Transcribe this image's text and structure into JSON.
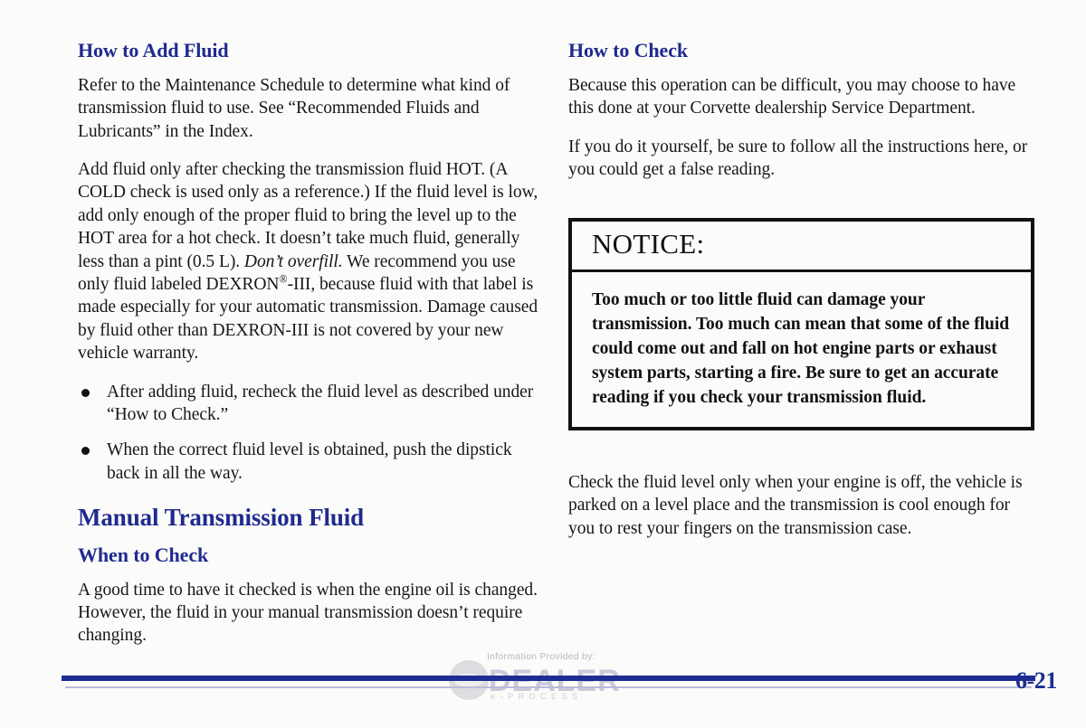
{
  "page": {
    "number": "6-21",
    "accent_color": "#1f2a8f",
    "footer_rule_color": "#1d2d93"
  },
  "left_column": {
    "heading_add_fluid": "How to Add Fluid",
    "paragraphs": [
      "Refer to the Maintenance Schedule to determine what kind of transmission fluid to use. See “Recommended Fluids and Lubricants” in the Index."
    ],
    "dexron_paragraph": {
      "part1": "Add fluid only after checking the transmission fluid HOT. (A COLD check is used only as a reference.) If the fluid level is low, add only enough of the proper fluid to bring the level up to the HOT area for a hot check. It doesn’t take much fluid, generally less than a pint (0.5 L). ",
      "italic": "Don’t overfill.",
      "part2": " We recommend you use only fluid labeled DEXRON",
      "registered": "®",
      "part3": "-III, because fluid with that label is made especially for your automatic transmission. Damage caused by fluid other than DEXRON-III is not covered by your new vehicle warranty."
    },
    "bullets": [
      "After adding fluid, recheck the fluid level as described under “How to Check.”",
      "When the correct fluid level is obtained, push the dipstick back in all the way."
    ],
    "heading_manual_transmission": "Manual Transmission Fluid",
    "heading_when_to_check": "When to Check",
    "when_to_check_paragraph": "A good time to have it checked is when the engine oil is changed. However, the fluid in your manual transmission doesn’t require changing."
  },
  "right_column": {
    "heading_how_to_check": "How to Check",
    "paragraph_1": "Because this operation can be difficult, you may choose to have this done at your Corvette dealership Service Department.",
    "paragraph_2": "If you do it yourself, be sure to follow all the instructions here, or you could get a false reading.",
    "notice": {
      "title": "NOTICE:",
      "body": "Too much or too little fluid can damage your transmission. Too much can mean that some of the fluid could come out and fall on hot engine parts or exhaust system parts, starting a fire. Be sure to get an accurate reading if you check your transmission fluid."
    },
    "paragraph_3": "Check the fluid level only when your engine is off, the vehicle is parked on a level place and the transmission is cool enough for you to rest your fingers on the transmission case."
  },
  "watermark": {
    "caption": "Information Provided by:",
    "brand": "DEALER",
    "sub": "e-PROCESS"
  }
}
